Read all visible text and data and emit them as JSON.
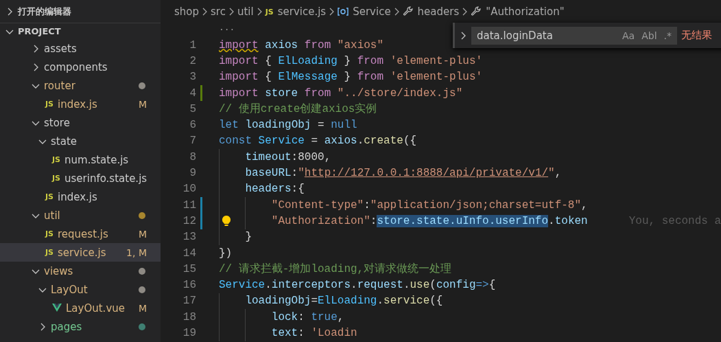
{
  "sidebar": {
    "sections": [
      {
        "title": "打开的编辑器",
        "expanded": false
      },
      {
        "title": "PROJECT",
        "expanded": true
      }
    ],
    "tree": [
      {
        "name": "assets",
        "kind": "folder",
        "expanded": false
      },
      {
        "name": "components",
        "kind": "folder",
        "expanded": false
      },
      {
        "name": "router",
        "kind": "folder",
        "expanded": true,
        "modified": true,
        "color": "#8e8a84",
        "children": [
          {
            "name": "index.js",
            "kind": "js",
            "icon_text": "JS",
            "modified": true,
            "badge": "M",
            "selected": false
          }
        ]
      },
      {
        "name": "store",
        "kind": "folder",
        "expanded": true,
        "children": [
          {
            "name": "state",
            "kind": "folder",
            "expanded": true,
            "children": [
              {
                "name": "num.state.js",
                "kind": "js",
                "icon_text": "JS",
                "selected": false
              },
              {
                "name": "userinfo.state.js",
                "kind": "js",
                "icon_text": "JS",
                "selected": false
              }
            ]
          },
          {
            "name": "index.js",
            "kind": "js",
            "icon_text": "JS",
            "selected": false
          }
        ]
      },
      {
        "name": "util",
        "kind": "folder",
        "expanded": true,
        "modified": true,
        "color": "#a8862e",
        "children": [
          {
            "name": "request.js",
            "kind": "js",
            "icon_text": "JS",
            "modified": true,
            "badge": "M",
            "selected": false
          },
          {
            "name": "service.js",
            "kind": "js",
            "icon_text": "JS",
            "modified": true,
            "badge": "1, M",
            "selected": true
          }
        ]
      },
      {
        "name": "views",
        "kind": "folder",
        "expanded": true,
        "modified": true,
        "color": "#8e8a84",
        "children": [
          {
            "name": "LayOut",
            "kind": "folder",
            "expanded": true,
            "modified": true,
            "color": "#8e8a84",
            "children": [
              {
                "name": "LayOut.vue",
                "kind": "vue",
                "modified": true,
                "badge": "M",
                "selected": false
              }
            ]
          },
          {
            "name": "pages",
            "kind": "folder",
            "expanded": false,
            "untracked": true,
            "color": "#3f7f72"
          }
        ]
      }
    ]
  },
  "breadcrumb": [
    {
      "text": "shop",
      "kind": "plain"
    },
    {
      "text": "src",
      "kind": "plain"
    },
    {
      "text": "util",
      "kind": "plain"
    },
    {
      "text": "service.js",
      "kind": "js",
      "icon_text": "JS"
    },
    {
      "text": "Service",
      "kind": "variable"
    },
    {
      "text": "headers",
      "kind": "property"
    },
    {
      "text": "\"Authorization\"",
      "kind": "property"
    }
  ],
  "find_widget": {
    "value": "data.loginData",
    "options": [
      "Aa",
      "Abl",
      ".*"
    ],
    "result": "无结果"
  },
  "editor": {
    "folded_marker": "...",
    "lines": [
      {
        "number": "1",
        "tokens": [
          {
            "kind": "kw",
            "text": "import",
            "warn": true
          },
          {
            "kind": "v",
            "text": " axios"
          },
          {
            "kind": "kw",
            "text": " from"
          },
          {
            "kind": "s",
            "text": " \"axios\""
          }
        ]
      },
      {
        "number": "2",
        "tokens": [
          {
            "kind": "kw",
            "text": "import"
          },
          {
            "kind": "p",
            "text": " { "
          },
          {
            "kind": "c",
            "text": "ElLoading"
          },
          {
            "kind": "p",
            "text": " } "
          },
          {
            "kind": "kw",
            "text": "from"
          },
          {
            "kind": "s",
            "text": " 'element-plus'"
          }
        ]
      },
      {
        "number": "3",
        "tokens": [
          {
            "kind": "kw",
            "text": "import"
          },
          {
            "kind": "p",
            "text": " { "
          },
          {
            "kind": "c",
            "text": "ElMessage"
          },
          {
            "kind": "p",
            "text": " } "
          },
          {
            "kind": "kw",
            "text": "from"
          },
          {
            "kind": "s",
            "text": " 'element-plus'"
          }
        ]
      },
      {
        "number": "4",
        "added": true,
        "tokens": [
          {
            "kind": "kw",
            "text": "import"
          },
          {
            "kind": "v",
            "text": " store"
          },
          {
            "kind": "kw",
            "text": " from"
          },
          {
            "kind": "s",
            "text": " \"../store/index.js\""
          }
        ]
      },
      {
        "number": "5",
        "tokens": [
          {
            "kind": "cm",
            "text": "// 使用create创建axios实例"
          }
        ]
      },
      {
        "number": "6",
        "tokens": [
          {
            "kind": "st",
            "text": "let"
          },
          {
            "kind": "v",
            "text": " loadingObj"
          },
          {
            "kind": "p",
            "text": " = "
          },
          {
            "kind": "st",
            "text": "null"
          }
        ]
      },
      {
        "number": "7",
        "tokens": [
          {
            "kind": "st",
            "text": "const"
          },
          {
            "kind": "c",
            "text": " Service"
          },
          {
            "kind": "p",
            "text": " = "
          },
          {
            "kind": "v",
            "text": "axios"
          },
          {
            "kind": "p",
            "text": "."
          },
          {
            "kind": "f",
            "text": "create"
          },
          {
            "kind": "p",
            "text": "({"
          }
        ]
      },
      {
        "number": "8",
        "tokens": [
          {
            "kind": "v",
            "text": "    timeout"
          },
          {
            "kind": "p",
            "text": ":"
          },
          {
            "kind": "n",
            "text": "8000"
          },
          {
            "kind": "p",
            "text": ","
          }
        ]
      },
      {
        "number": "9",
        "tokens": [
          {
            "kind": "v",
            "text": "    baseURL"
          },
          {
            "kind": "p",
            "text": ":"
          },
          {
            "kind": "s",
            "text": "\""
          },
          {
            "kind": "u",
            "text": "http://127.0.0.1:8888/api/private/v1/"
          },
          {
            "kind": "s",
            "text": "\""
          },
          {
            "kind": "p",
            "text": ","
          }
        ]
      },
      {
        "number": "10",
        "tokens": [
          {
            "kind": "v",
            "text": "    headers"
          },
          {
            "kind": "p",
            "text": ":{"
          }
        ]
      },
      {
        "number": "11",
        "modified": true,
        "tokens": [
          {
            "kind": "s",
            "text": "        \"Content-type\""
          },
          {
            "kind": "p",
            "text": ":"
          },
          {
            "kind": "s",
            "text": "\"application/json;charset=utf-8\""
          },
          {
            "kind": "p",
            "text": ","
          }
        ]
      },
      {
        "number": "12",
        "modified": true,
        "lightbulb": true,
        "blame": "You, seconds a",
        "tokens": [
          {
            "kind": "s",
            "text": "        \"Authorization\""
          },
          {
            "kind": "p",
            "text": ":"
          },
          {
            "kind": "v",
            "text": "store.state.uInfo.userInfo",
            "sel": true
          },
          {
            "kind": "p",
            "text": "."
          },
          {
            "kind": "v",
            "text": "token"
          }
        ]
      },
      {
        "number": "13",
        "tokens": [
          {
            "kind": "p",
            "text": "    }"
          }
        ]
      },
      {
        "number": "14",
        "tokens": [
          {
            "kind": "p",
            "text": "})"
          }
        ]
      },
      {
        "number": "15",
        "tokens": [
          {
            "kind": "cm",
            "text": "// 请求拦截-增加loading,对请求做统一处理"
          }
        ]
      },
      {
        "number": "16",
        "tokens": [
          {
            "kind": "c",
            "text": "Service"
          },
          {
            "kind": "p",
            "text": "."
          },
          {
            "kind": "v",
            "text": "interceptors"
          },
          {
            "kind": "p",
            "text": "."
          },
          {
            "kind": "v",
            "text": "request"
          },
          {
            "kind": "p",
            "text": "."
          },
          {
            "kind": "f",
            "text": "use"
          },
          {
            "kind": "p",
            "text": "("
          },
          {
            "kind": "v",
            "text": "config"
          },
          {
            "kind": "st",
            "text": "=>"
          },
          {
            "kind": "p",
            "text": "{"
          }
        ]
      },
      {
        "number": "17",
        "tokens": [
          {
            "kind": "v",
            "text": "    loadingObj"
          },
          {
            "kind": "p",
            "text": "="
          },
          {
            "kind": "c",
            "text": "ElLoading"
          },
          {
            "kind": "p",
            "text": "."
          },
          {
            "kind": "f",
            "text": "service"
          },
          {
            "kind": "p",
            "text": "({"
          }
        ]
      },
      {
        "number": "18",
        "tokens": [
          {
            "kind": "v",
            "text": "        lock"
          },
          {
            "kind": "p",
            "text": ": "
          },
          {
            "kind": "st",
            "text": "true"
          },
          {
            "kind": "p",
            "text": ","
          }
        ]
      },
      {
        "number": "19",
        "tokens": [
          {
            "kind": "v",
            "text": "        text"
          },
          {
            "kind": "p",
            "text": ": "
          },
          {
            "kind": "s",
            "text": "'Loadin"
          }
        ]
      }
    ]
  }
}
